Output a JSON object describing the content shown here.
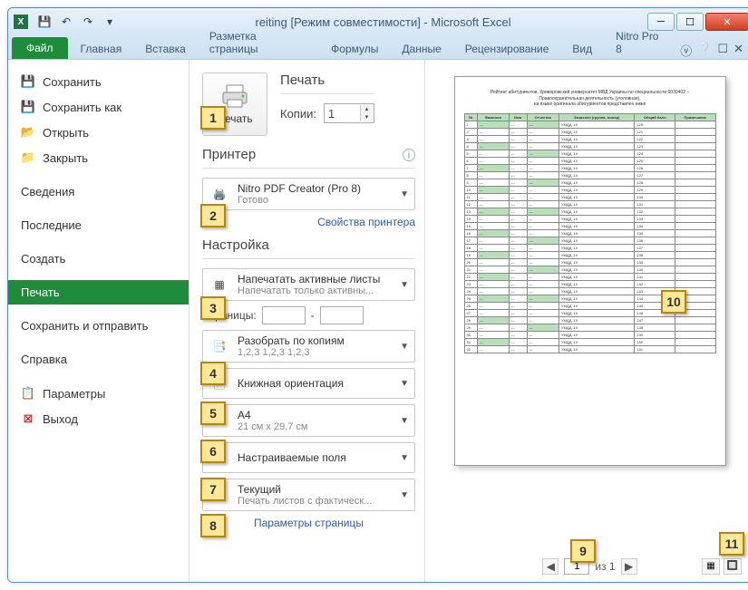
{
  "window": {
    "title": "reiting  [Режим совместимости]  -  Microsoft Excel"
  },
  "ribbon": {
    "file": "Файл",
    "tabs": [
      "Главная",
      "Вставка",
      "Разметка страницы",
      "Формулы",
      "Данные",
      "Рецензирование",
      "Вид",
      "Nitro Pro 8"
    ]
  },
  "menu": {
    "save": "Сохранить",
    "save_as": "Сохранить как",
    "open": "Открыть",
    "close": "Закрыть",
    "info": "Сведения",
    "recent": "Последние",
    "new": "Создать",
    "print": "Печать",
    "share": "Сохранить и отправить",
    "help": "Справка",
    "options": "Параметры",
    "exit": "Выход"
  },
  "print": {
    "title": "Печать",
    "button": "Печать",
    "copies_label": "Копии:",
    "copies_value": "1",
    "printer_section": "Принтер",
    "printer_name": "Nitro PDF Creator (Pro 8)",
    "printer_status": "Готово",
    "printer_props": "Свойства принтера",
    "settings_section": "Настройка",
    "setting_active": "Напечатать активные листы",
    "setting_active_sub": "Напечатать только активны...",
    "pages_label": "Страницы:",
    "pages_to": "-",
    "collate": "Разобрать по копиям",
    "collate_sub": "1,2,3   1,2,3   1,2,3",
    "orientation": "Книжная ориентация",
    "paper": "A4",
    "paper_sub": "21 см x 29,7 см",
    "margins": "Настраиваемые поля",
    "scaling": "Текущий",
    "scaling_sub": "Печать листов с фактическ...",
    "page_setup": "Параметры страницы"
  },
  "preview": {
    "page_current": "1",
    "page_of": "из 1"
  },
  "callouts": {
    "1": "1",
    "2": "2",
    "3": "3",
    "4": "4",
    "5": "5",
    "6": "6",
    "7": "7",
    "8": "8",
    "9": "9",
    "10": "10",
    "11": "11"
  }
}
